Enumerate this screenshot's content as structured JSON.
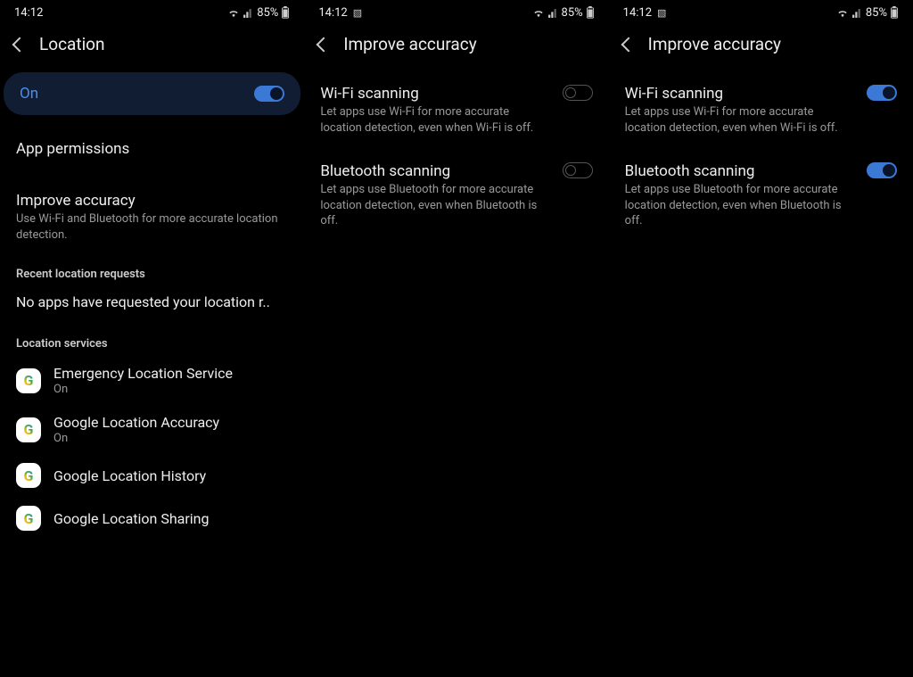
{
  "statusbar": {
    "time": "14:12",
    "battery_pct": "85%"
  },
  "screen1": {
    "title": "Location",
    "master": {
      "label": "On"
    },
    "app_perms": "App permissions",
    "improve": {
      "title": "Improve accuracy",
      "desc": "Use Wi-Fi and Bluetooth for more accurate location detection."
    },
    "recent_label": "Recent location requests",
    "no_apps": "No apps have requested your location r..",
    "services_label": "Location services",
    "services": [
      {
        "title": "Emergency Location Service",
        "sub": "On"
      },
      {
        "title": "Google Location Accuracy",
        "sub": "On"
      },
      {
        "title": "Google Location History",
        "sub": ""
      },
      {
        "title": "Google Location Sharing",
        "sub": ""
      }
    ]
  },
  "screen2": {
    "title": "Improve accuracy",
    "wifi": {
      "title": "Wi-Fi scanning",
      "desc": "Let apps use Wi-Fi for more accurate location detection, even when Wi-Fi is off."
    },
    "bt": {
      "title": "Bluetooth scanning",
      "desc": "Let apps use Bluetooth for more accurate location detection, even when Bluetooth is off."
    }
  },
  "screen3": {
    "title": "Improve accuracy",
    "wifi": {
      "title": "Wi-Fi scanning",
      "desc": "Let apps use Wi-Fi for more accurate location detection, even when Wi-Fi is off."
    },
    "bt": {
      "title": "Bluetooth scanning",
      "desc": "Let apps use Bluetooth for more accurate location detection, even when Bluetooth is off."
    }
  }
}
